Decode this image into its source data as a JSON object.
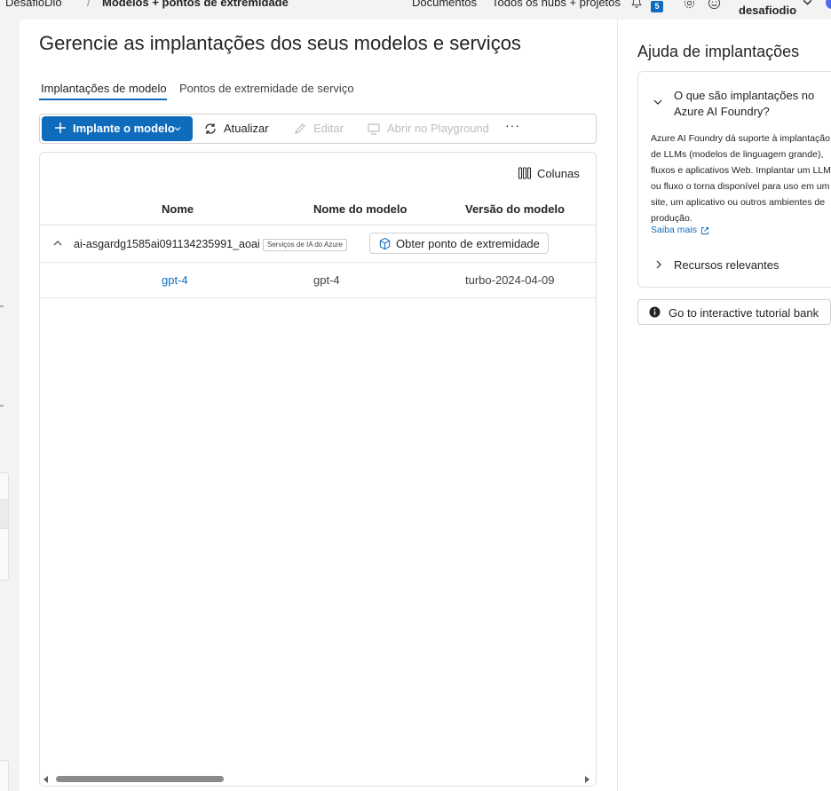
{
  "topbar": {
    "project": "DesafioDio",
    "page": "Modelos + pontos de extremidade",
    "docs_label": "Documentos",
    "hubs_label": "Todos os hubs + projetos",
    "notification_count": "5",
    "user_name": "desafiodio"
  },
  "main": {
    "title": "Gerencie as implantações dos seus modelos e serviços",
    "tabs": [
      {
        "label": "Implantações de modelo",
        "active": true
      },
      {
        "label": "Pontos de extremidade de serviço",
        "active": false
      }
    ],
    "toolbar": {
      "deploy_label": "Implante o modelo",
      "refresh_label": "Atualizar",
      "edit_label": "Editar",
      "playground_label": "Abrir no Playground",
      "more_label": "···"
    },
    "grid": {
      "columns_label": "Colunas",
      "headers": [
        "Nome",
        "Nome do modelo",
        "Versão do modelo"
      ],
      "group": {
        "name": "ai-asgardg1585ai091134235991_aoai",
        "badge": "Serviços de IA do Azure",
        "endpoint_button": "Obter ponto de extremidade"
      },
      "rows": [
        {
          "name": "gpt-4",
          "model": "gpt-4",
          "version": "turbo-2024-04-09"
        }
      ]
    }
  },
  "help": {
    "title": "Ajuda de implantações",
    "question": "O que são implantações no Azure AI Foundry?",
    "body": "Azure AI Foundry dá suporte à implantação de LLMs (modelos de linguagem grande), fluxos e aplicativos Web. Implantar um LLM ou fluxo o torna disponível para uso em um site, um aplicativo ou outros ambientes de produção.",
    "learn_more": "Saiba mais",
    "resources_label": "Recursos relevantes",
    "tutorial_button": "Go to interactive tutorial bank"
  },
  "colors": {
    "accent": "#0f6cbd",
    "background": "#f3f3f3",
    "card": "#ffffff",
    "disabled_text": "#bdbdbd"
  }
}
